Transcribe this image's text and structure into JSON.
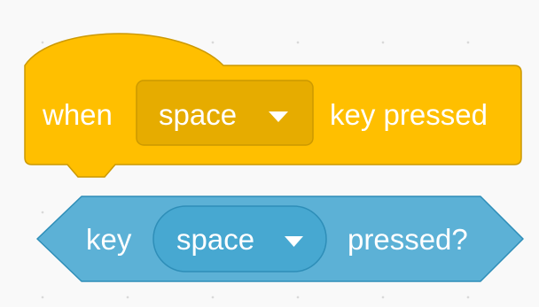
{
  "workspace": {
    "hat_block": {
      "category": "events",
      "prefix": "when",
      "dropdown_value": "space",
      "suffix": "key pressed",
      "colors": {
        "fill": "#FFBF00",
        "border": "#CC9900",
        "field": "#E6AC00"
      }
    },
    "boolean_block": {
      "category": "sensing",
      "prefix": "key",
      "dropdown_value": "space",
      "suffix": "pressed?",
      "colors": {
        "fill": "#5CB1D6",
        "border": "#2E8EB8",
        "field": "#47A8D1"
      }
    },
    "icons": {
      "dropdown": "triangle-down-icon"
    }
  }
}
